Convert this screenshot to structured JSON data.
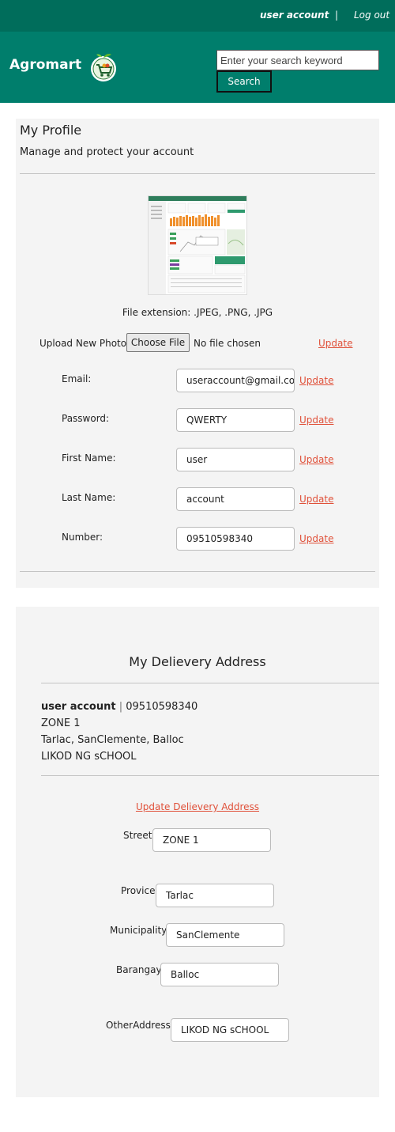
{
  "topbar": {
    "user": "user account",
    "separator": "|",
    "logout": "Log out"
  },
  "header": {
    "brand": "Agromart",
    "search_placeholder": "Enter your search keyword",
    "search_button": "Search"
  },
  "profile": {
    "title": "My Profile",
    "subtitle": "Manage and protect your account",
    "file_extension": "File extension: .JPEG, .PNG, .JPG",
    "upload_label": "Upload New Photo:",
    "choose_file": "Choose File",
    "no_file": "No file chosen",
    "update_label": "Update",
    "fields": [
      {
        "label": "Email:",
        "value": "useraccount@gmail.com"
      },
      {
        "label": "Password:",
        "value": "QWERTY"
      },
      {
        "label": "First Name:",
        "value": "user"
      },
      {
        "label": "Last Name:",
        "value": "account"
      },
      {
        "label": "Number:",
        "value": "09510598340"
      }
    ]
  },
  "address": {
    "title": "My Delievery Address",
    "name": "user account",
    "separator": "|",
    "phone": "09510598340",
    "line1": "ZONE 1",
    "line2": "Tarlac, SanClemente, Balloc",
    "line3": "LIKOD NG sCHOOL",
    "update_link": "Update Delievery Address",
    "fields": [
      {
        "label": "Street:",
        "value": "ZONE 1"
      },
      {
        "label": "Provice:",
        "value": "Tarlac"
      },
      {
        "label": "Municipality:",
        "value": "SanClemente"
      },
      {
        "label": "Barangay:",
        "value": "Balloc"
      },
      {
        "label": "OtherAddress:",
        "value": "LIKOD NG sCHOOL"
      }
    ]
  },
  "colors": {
    "primary": "#007e6c",
    "topbar": "#006d5b",
    "link": "#e0513a",
    "card": "#f4f4f4"
  }
}
